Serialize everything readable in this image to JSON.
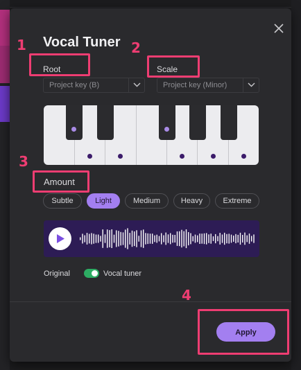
{
  "dialog": {
    "title": "Vocal Tuner",
    "close_icon": "close-icon"
  },
  "root": {
    "label": "Root",
    "value": "Project key (B)",
    "chevron_icon": "chevron-down-icon"
  },
  "scale": {
    "label": "Scale",
    "value": "Project key (Minor)",
    "chevron_icon": "chevron-down-icon"
  },
  "amount": {
    "label": "Amount",
    "options": [
      "Subtle",
      "Light",
      "Medium",
      "Heavy",
      "Extreme"
    ],
    "selected": "Light"
  },
  "player": {
    "play_icon": "play-icon"
  },
  "toggle": {
    "left_label": "Original",
    "right_label": "Vocal tuner",
    "state": "on"
  },
  "footer": {
    "apply_label": "Apply"
  },
  "annotations": {
    "step1": "1",
    "step2": "2",
    "step3": "3",
    "step4": "4"
  },
  "colors": {
    "accent": "#a37ff0",
    "annotation": "#ee3d72",
    "toggle_on": "#2dac63",
    "wave_bg": "#2d1c55"
  }
}
